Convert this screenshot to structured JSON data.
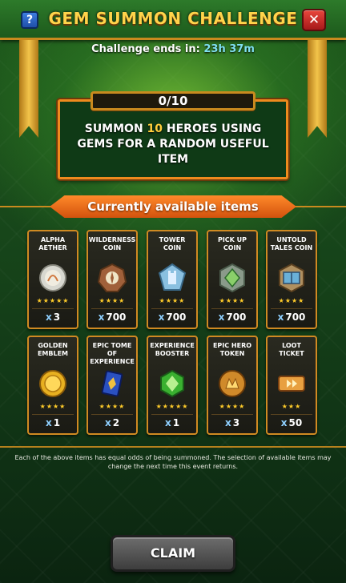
{
  "header": {
    "title": "GEM SUMMON CHALLENGE",
    "help_label": "?",
    "close_label": "✕"
  },
  "timer": {
    "label": "Challenge ends in:",
    "value": "23h 37m"
  },
  "challenge": {
    "progress_text": "0/10",
    "progress_current": 0,
    "progress_total": 10,
    "text_before": "SUMMON ",
    "highlight": "10",
    "text_after": " HEROES USING GEMS FOR A RANDOM USEFUL ITEM"
  },
  "section_title": "Currently available items",
  "items": [
    {
      "name": "ALPHA AETHER",
      "stars": "★★★★★",
      "qty": "3",
      "icon": "aether-orb-icon",
      "color": "#c9c9c0"
    },
    {
      "name": "WILDERNESS COIN",
      "stars": "★★★★",
      "qty": "700",
      "icon": "wilderness-coin-icon",
      "color": "#a0603a"
    },
    {
      "name": "TOWER COIN",
      "stars": "★★★★",
      "qty": "700",
      "icon": "tower-coin-icon",
      "color": "#8ac0e0"
    },
    {
      "name": "PICK UP COIN",
      "stars": "★★★★",
      "qty": "700",
      "icon": "pickup-coin-icon",
      "color": "#8acf6a"
    },
    {
      "name": "UNTOLD TALES COIN",
      "stars": "★★★★",
      "qty": "700",
      "icon": "untold-tales-coin-icon",
      "color": "#6ab0d8"
    },
    {
      "name": "GOLDEN EMBLEM",
      "stars": "★★★★",
      "qty": "1",
      "icon": "golden-emblem-icon",
      "color": "#e8b020"
    },
    {
      "name": "EPIC TOME OF EXPERIENCE",
      "stars": "★★★★",
      "qty": "2",
      "icon": "epic-tome-icon",
      "color": "#2a50c0"
    },
    {
      "name": "EXPERIENCE BOOSTER",
      "stars": "★★★★★",
      "qty": "1",
      "icon": "experience-booster-icon",
      "color": "#3ab030"
    },
    {
      "name": "EPIC HERO TOKEN",
      "stars": "★★★★",
      "qty": "3",
      "icon": "epic-hero-token-icon",
      "color": "#d08a2a"
    },
    {
      "name": "LOOT TICKET",
      "stars": "★★★",
      "qty": "50",
      "icon": "loot-ticket-icon",
      "color": "#e8a040"
    }
  ],
  "qty_prefix": "x",
  "footnote": "Each of the above items has equal odds of being summoned. The selection of available items may change the next time this event returns.",
  "claim_label": "CLAIM"
}
